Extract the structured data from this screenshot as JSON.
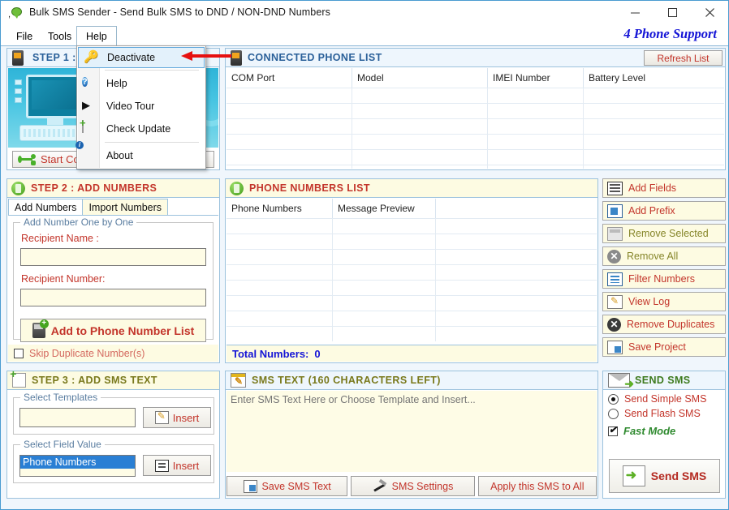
{
  "window": {
    "title": "Bulk SMS Sender - Send Bulk SMS to DND / NON-DND Numbers",
    "minimize": "—",
    "maximize": "□",
    "close": "✕"
  },
  "menubar": {
    "items": [
      {
        "label": "File"
      },
      {
        "label": "Tools"
      },
      {
        "label": "Help"
      }
    ],
    "brand": "4 Phone Support"
  },
  "help_menu": {
    "items": [
      {
        "label": "Deactivate",
        "icon": "key-icon",
        "selected": true
      },
      {
        "label": "Help",
        "icon": "question-circle-icon",
        "selected": false
      },
      {
        "label": "Video Tour",
        "icon": "play-icon",
        "selected": false
      },
      {
        "label": "Check Update",
        "icon": "page-plus-icon",
        "selected": false
      },
      {
        "label": "About",
        "icon": "about-info-icon",
        "selected": false
      }
    ]
  },
  "step1": {
    "title": "STEP 1 :",
    "connect_button": "Start Connecting Phones"
  },
  "connected_phone_list": {
    "title": "CONNECTED PHONE LIST",
    "refresh_label": "Refresh List",
    "columns": [
      "COM  Port",
      "Model",
      "IMEI Number",
      "Battery Level"
    ],
    "rows": []
  },
  "step2": {
    "title": "STEP 2 : ADD NUMBERS",
    "tabs": [
      {
        "label": "Add Numbers",
        "active": true
      },
      {
        "label": "Import Numbers",
        "active": false
      }
    ],
    "group_legend": "Add Number One by One",
    "recipient_name_label": "Recipient Name :",
    "recipient_name_value": "",
    "recipient_number_label": "Recipient Number:",
    "recipient_number_value": "",
    "add_button": "Add to Phone Number List",
    "skip_duplicates_label": "Skip Duplicate Number(s)",
    "skip_duplicates_checked": false
  },
  "phone_numbers_list": {
    "title": "PHONE NUMBERS LIST",
    "columns": [
      "Phone Numbers",
      "Message Preview",
      ""
    ],
    "rows": [],
    "total_label": "Total Numbers:",
    "total_value": "0"
  },
  "right_buttons": [
    {
      "label": "Add Fields",
      "icon": "add-fields-icon",
      "disabled": false
    },
    {
      "label": "Add Prefix",
      "icon": "add-prefix-icon",
      "disabled": false
    },
    {
      "label": "Remove Selected",
      "icon": "remove-selected-icon",
      "disabled": true
    },
    {
      "label": "Remove All",
      "icon": "remove-all-icon",
      "disabled": true
    },
    {
      "label": "Filter Numbers",
      "icon": "filter-numbers-icon",
      "disabled": false
    },
    {
      "label": "View Log",
      "icon": "view-log-icon",
      "disabled": false
    },
    {
      "label": "Remove Duplicates",
      "icon": "remove-duplicates-icon",
      "disabled": false
    },
    {
      "label": "Save Project",
      "icon": "save-project-icon",
      "disabled": false
    }
  ],
  "step3": {
    "title": "STEP 3 : ADD SMS TEXT",
    "templates_legend": "Select Templates",
    "templates_value": "",
    "templates_insert": "Insert",
    "field_value_legend": "Select Field Value",
    "field_value_selected": "Phone Numbers",
    "field_insert": "Insert"
  },
  "sms_text": {
    "title": "SMS TEXT (160 CHARACTERS LEFT)",
    "placeholder": "Enter SMS Text Here or Choose Template and Insert...",
    "value": "",
    "buttons": [
      {
        "label": "Save SMS Text",
        "icon": "save-sms-icon"
      },
      {
        "label": "SMS Settings",
        "icon": "settings-icon"
      },
      {
        "label": "Apply this SMS to All",
        "icon": "none"
      }
    ]
  },
  "send_sms": {
    "title": "SEND SMS",
    "options": [
      {
        "label": "Send Simple SMS",
        "selected": true
      },
      {
        "label": "Send Flash SMS",
        "selected": false
      }
    ],
    "fast_mode_label": "Fast Mode",
    "fast_mode_checked": true,
    "send_button": "Send SMS"
  },
  "colors": {
    "accent_blue": "#2a6099",
    "title_red": "#c3352b",
    "brand_blue": "#1414d6",
    "green": "#3d7a1e",
    "cream": "#fdfbe2",
    "arrow_red": "#e61010"
  }
}
